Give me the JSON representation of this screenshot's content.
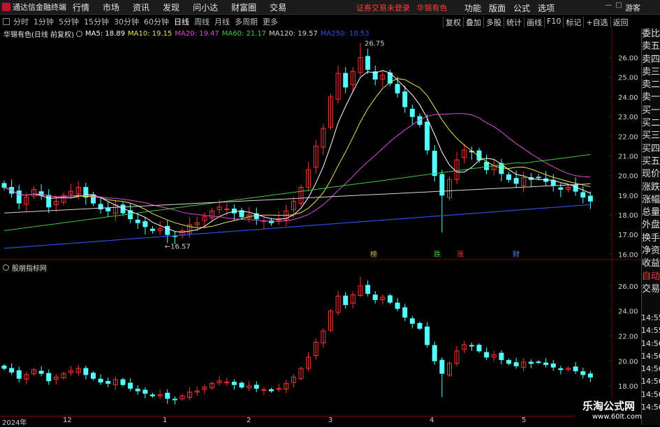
{
  "app": {
    "title": "通达信金融终端",
    "menu": [
      "行情",
      "市场",
      "资讯",
      "发现",
      "问小达",
      "财富圈",
      "交易"
    ],
    "center_notice": "证券交易未登录",
    "center_stock": "华锡有色",
    "right_menu": [
      "功能",
      "版面",
      "公式",
      "选项"
    ],
    "guest": "游客"
  },
  "period_bar": {
    "periods": [
      "分时",
      "1分钟",
      "5分钟",
      "15分钟",
      "30分钟",
      "60分钟",
      "日线",
      "周线",
      "月线",
      "多周期",
      "更多"
    ],
    "active": "日线",
    "tools": [
      "复权",
      "叠加",
      "多股",
      "统计",
      "画线",
      "F10",
      "标记",
      "+自选",
      "返回"
    ]
  },
  "info": {
    "stock": "华锡有色(日线 前复权)",
    "ma": [
      {
        "label": "MA5: 18.89",
        "color": "#ffffff"
      },
      {
        "label": "MA10: 19.15",
        "color": "#e8e84a"
      },
      {
        "label": "MA20: 19.47",
        "color": "#e04ae0"
      },
      {
        "label": "MA60: 21.17",
        "color": "#3acb3a"
      },
      {
        "label": "MA120: 19.57",
        "color": "#d8d8d8"
      },
      {
        "label": "MA250: 18.53",
        "color": "#2d4de0"
      }
    ]
  },
  "right_column": [
    "委比",
    "卖五",
    "卖四",
    "卖三",
    "卖二",
    "卖一",
    "买一",
    "买二",
    "买三",
    "买四",
    "买五",
    "现价",
    "涨跌",
    "涨幅",
    "总量",
    "外盘",
    "换手",
    "净资",
    "收益",
    "自动",
    "交易"
  ],
  "right_column_times": [
    "14:55",
    "14:55",
    "14:56",
    "14:56",
    "14:56",
    "14:56",
    "14:56",
    "14:56"
  ],
  "lower_panel": {
    "label": "股朋指标网"
  },
  "markers": {
    "high": "26.75",
    "low": "16.57",
    "events": [
      "榜",
      "跌",
      "涨",
      "财"
    ]
  },
  "date_axis": [
    "2024年",
    "12",
    "1",
    "2",
    "3",
    "4",
    "5"
  ],
  "watermark": {
    "line1": "乐淘公式网",
    "line2": "www.60lt.com"
  },
  "chart_data": [
    {
      "type": "candlestick",
      "title": "华锡有色(日线 前复权)",
      "ylim": [
        15.8,
        26.8
      ],
      "yticks": [
        16.0,
        17.0,
        18.0,
        19.0,
        20.0,
        21.0,
        22.0,
        23.0,
        24.0,
        25.0,
        26.0
      ],
      "x": [
        "2024-11",
        "2024-12",
        "2025-01",
        "2025-02",
        "2025-03",
        "2025-04",
        "2025-05"
      ],
      "closes": [
        19.4,
        19.1,
        18.6,
        18.9,
        19.3,
        19.0,
        18.4,
        18.7,
        19.0,
        19.2,
        19.4,
        18.9,
        18.6,
        18.3,
        18.2,
        18.5,
        18.1,
        17.8,
        17.6,
        17.4,
        17.2,
        17.3,
        17.0,
        16.9,
        17.2,
        17.5,
        17.6,
        17.9,
        18.2,
        18.4,
        18.3,
        18.1,
        17.9,
        18.0,
        17.8,
        17.7,
        17.6,
        17.8,
        18.2,
        18.7,
        19.4,
        20.3,
        21.5,
        22.4,
        24.0,
        25.2,
        24.5,
        25.3,
        26.0,
        25.4,
        24.9,
        25.1,
        24.7,
        24.2,
        23.5,
        23.0,
        22.6,
        21.3,
        20.0,
        19.0,
        19.8,
        20.8,
        21.3,
        21.2,
        20.8,
        20.3,
        20.5,
        20.1,
        19.8,
        19.6,
        19.9,
        19.8,
        19.9,
        19.7,
        19.5,
        19.3,
        19.4,
        19.2,
        18.9,
        18.7
      ],
      "series": [
        {
          "name": "MA5",
          "last": 18.89
        },
        {
          "name": "MA10",
          "last": 19.15
        },
        {
          "name": "MA20",
          "last": 19.47
        },
        {
          "name": "MA60",
          "last": 21.17
        },
        {
          "name": "MA120",
          "last": 19.57
        },
        {
          "name": "MA250",
          "last": 18.53
        }
      ]
    },
    {
      "type": "candlestick",
      "title": "股朋指标网",
      "ylim": [
        17.5,
        27.0
      ],
      "yticks": [
        18.0,
        20.0,
        22.0,
        24.0,
        26.0
      ]
    }
  ]
}
